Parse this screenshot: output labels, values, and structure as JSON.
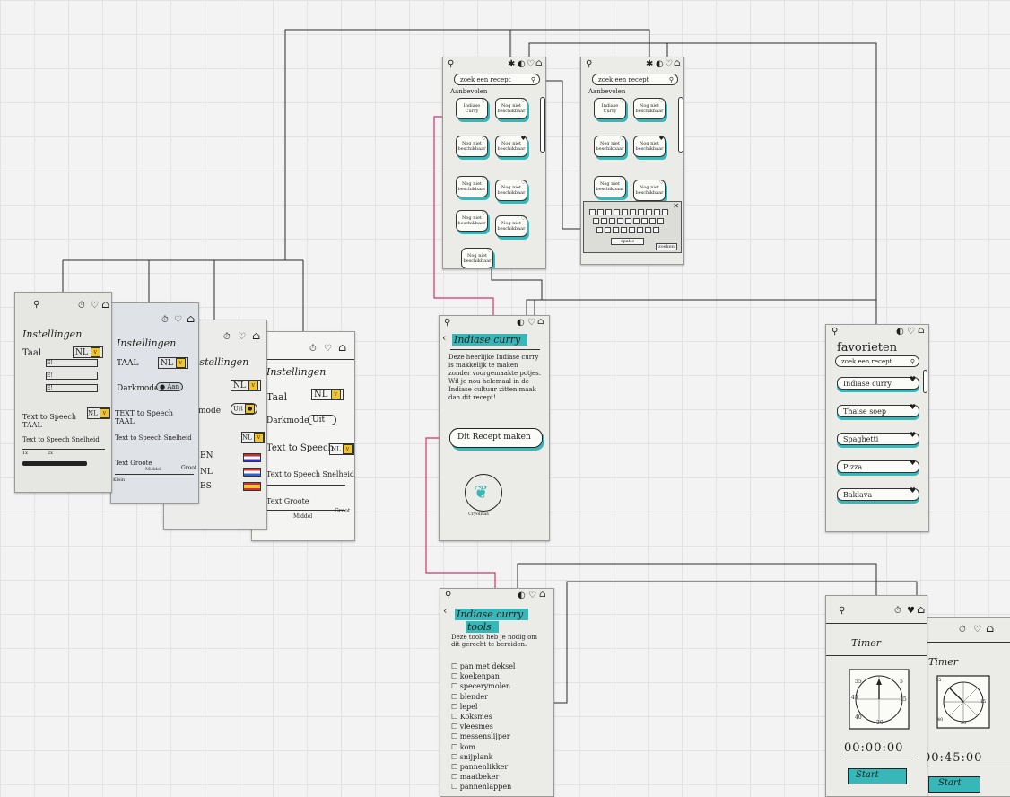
{
  "home": {
    "search_placeholder": "zoek een recept",
    "section_label": "Aanbevolen",
    "tiles": [
      "Indiase Curry",
      "Nog niet beschikbaar",
      "Nog niet beschikbaar",
      "Nog niet beschikbaar",
      "Nog niet beschikbaar",
      "Nog niet beschikbaar",
      "Nog niet beschikbaar",
      "Nog niet beschikbaar",
      "Nog niet beschikbaar"
    ]
  },
  "keyboard": {
    "space_label": "spatie",
    "enter_label": "zoeken"
  },
  "settings": {
    "title": "Instellingen",
    "language_label": "Taal",
    "language_value": "NL",
    "languages": [
      "EN",
      "NL",
      "ES"
    ],
    "darkmode_label": "Darkmode",
    "darkmode_on": "Aan",
    "darkmode_off": "Uit",
    "tts_label": "Text to Speech",
    "tts_speed_label": "Text to Speech Snelheid",
    "tts_speed_ticks": [
      "1x",
      "2x"
    ],
    "text_size_label": "Text Groote",
    "text_size_ticks": [
      "Klein",
      "Middel",
      "Groot"
    ]
  },
  "recipe": {
    "title": "Indiase curry",
    "description": "Deze heerlijke Indiase curry is makkelijk te maken zonder voorgemaakte potjes. Wil je nou helemaal in de Indiase cultuur zitten maak dan dit recept!",
    "make_button": "Dit Recept maken",
    "logo_caption": "Cryolitas"
  },
  "tools": {
    "title": "Indiase curry",
    "subtitle": "tools",
    "intro": "Deze tools heb je nodig om dit gerecht te bereiden.",
    "items": [
      "pan met deksel",
      "koekenpan",
      "specerymolen",
      "blender",
      "lepel",
      "Koksmes",
      "vleesmes",
      "messenslijper",
      "kom",
      "snijplank",
      "pannenlikker",
      "maatbeker",
      "pannenlappen"
    ]
  },
  "favorites": {
    "title": "favorieten",
    "search_placeholder": "zoek een recept",
    "items": [
      "Indiase curry",
      "Thaise soep",
      "Spaghetti",
      "Pizza",
      "Baklava"
    ]
  },
  "timer": {
    "title": "Timer",
    "dial_numbers": [
      "55",
      "5",
      "15",
      "45",
      "40",
      "20"
    ],
    "time_a": "00:00:00",
    "time_b": "00:45:00",
    "start_button": "Start"
  },
  "colors": {
    "accent": "#38b7b9",
    "link": "#d6336c",
    "wire": "#2b2b2b",
    "highlight": "#f1c531"
  },
  "icons": [
    "search-icon",
    "settings-icon",
    "timer-icon",
    "heart-icon",
    "home-icon",
    "back-arrow-icon",
    "close-icon"
  ]
}
